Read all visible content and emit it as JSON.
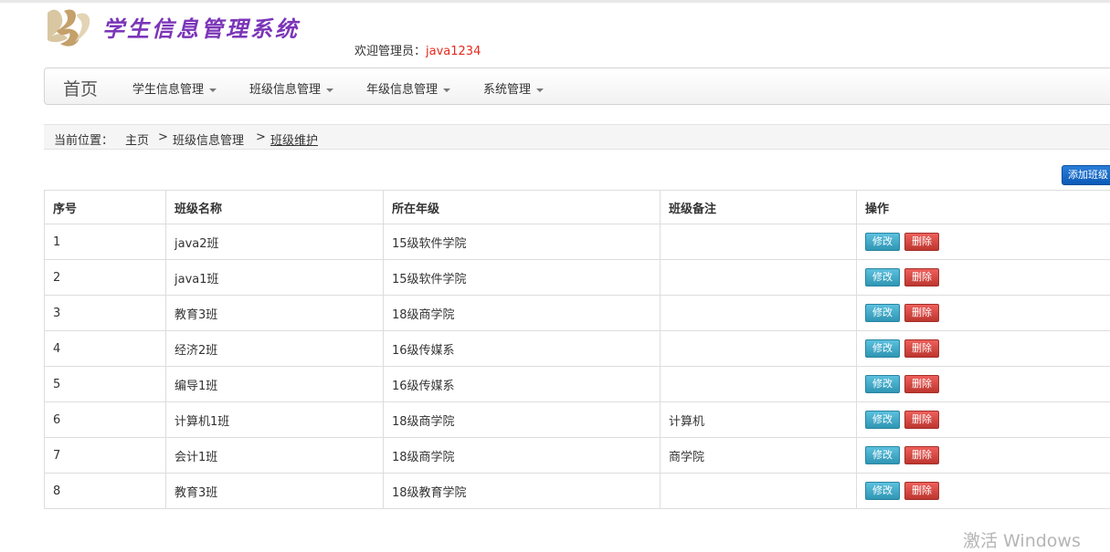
{
  "header": {
    "title": "学生信息管理系统",
    "welcome_label": "欢迎管理员：",
    "username": "java1234"
  },
  "nav": {
    "home": "首页",
    "items": [
      "学生信息管理",
      "班级信息管理",
      "年级信息管理",
      "系统管理"
    ]
  },
  "breadcrumb": {
    "label": "当前位置：",
    "home": "主页",
    "section": "班级信息管理",
    "current": "班级维护",
    "separator": ">"
  },
  "toolbar": {
    "add_label": "添加班级"
  },
  "table": {
    "headers": [
      "序号",
      "班级名称",
      "所在年级",
      "班级备注",
      "操作"
    ],
    "edit_label": "修改",
    "delete_label": "删除",
    "rows": [
      [
        "1",
        "java2班",
        "15级软件学院",
        ""
      ],
      [
        "2",
        "java1班",
        "15级软件学院",
        ""
      ],
      [
        "3",
        "教育3班",
        "18级商学院",
        ""
      ],
      [
        "4",
        "经济2班",
        "16级传媒系",
        ""
      ],
      [
        "5",
        "编导1班",
        "16级传媒系",
        ""
      ],
      [
        "6",
        "计算机1班",
        "18级商学院",
        "计算机"
      ],
      [
        "7",
        "会计1班",
        "18级商学院",
        "商学院"
      ],
      [
        "8",
        "教育3班",
        "18级教育学院",
        ""
      ]
    ]
  },
  "watermark": "激活 Windows",
  "colors": {
    "title": "#7b35b8",
    "username": "#e52a1c",
    "primary_button": "#1565c0",
    "edit_button": "#49afcd",
    "delete_button": "#da4f49"
  },
  "icons": {
    "logo": "ys-logo-icon",
    "dropdown": "caret-down-icon"
  }
}
